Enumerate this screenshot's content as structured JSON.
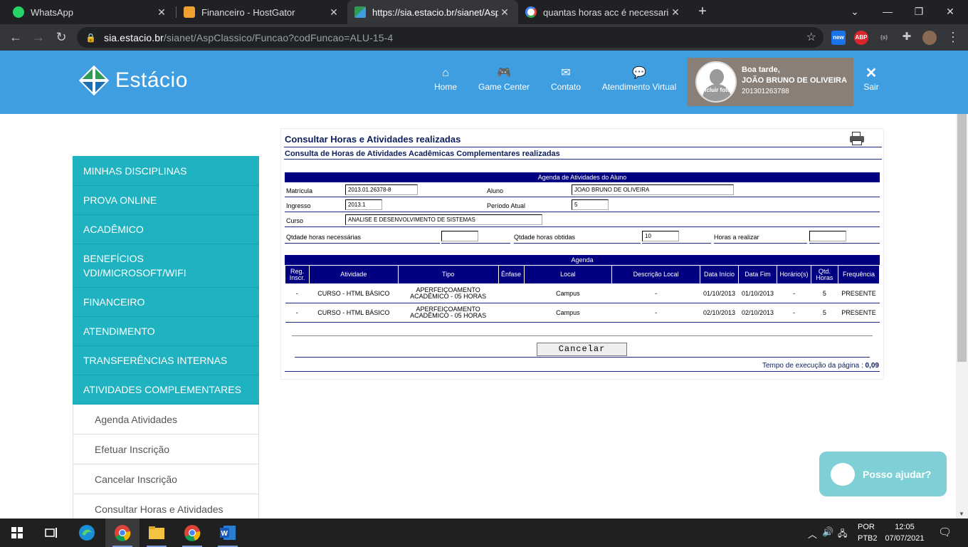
{
  "browser": {
    "tabs": [
      {
        "title": "WhatsApp",
        "icon": "whatsapp-icon",
        "color": "#25d366"
      },
      {
        "title": "Financeiro - HostGator",
        "icon": "hostgator-icon",
        "color": "#f0a030"
      },
      {
        "title": "https://sia.estacio.br/sianet/AspC",
        "icon": "estacio-favicon",
        "color": "#3e9ee0"
      },
      {
        "title": "quantas horas acc é necessario p",
        "icon": "google-icon",
        "color": "#ffffff"
      }
    ],
    "url_host": "sia.estacio.br",
    "url_path": "/sianet/AspClassico/Funcao?codFuncao=ALU-15-4",
    "ext_new": "new",
    "ext_abp": "ABP",
    "ext_s": "(s)"
  },
  "header": {
    "logo_text": "Estácio",
    "nav": [
      {
        "label": "Home",
        "icon": "home-icon",
        "glyph": "⌂"
      },
      {
        "label": "Game Center",
        "icon": "gamepad-icon",
        "glyph": "🎮"
      },
      {
        "label": "Contato",
        "icon": "envelope-icon",
        "glyph": "✉"
      },
      {
        "label": "Atendimento Virtual",
        "icon": "chat-icon",
        "glyph": "💬"
      }
    ],
    "avatar_label": "Incluir foto",
    "greeting": "Boa tarde,",
    "user_name": "JOÃO BRUNO DE OLIVEIRA",
    "user_id": "201301263788",
    "logout": "Sair"
  },
  "sidebar": {
    "items": [
      {
        "label": "MINHAS DISCIPLINAS"
      },
      {
        "label": "PROVA ONLINE"
      },
      {
        "label": "ACADÊMICO"
      },
      {
        "label": "BENEFÍCIOS VDI/MICROSOFT/WIFI"
      },
      {
        "label": "FINANCEIRO"
      },
      {
        "label": "ATENDIMENTO"
      },
      {
        "label": "TRANSFERÊNCIAS INTERNAS"
      },
      {
        "label": "ATIVIDADES COMPLEMENTARES"
      }
    ],
    "subitems": [
      {
        "label": "Agenda Atividades"
      },
      {
        "label": "Efetuar Inscrição"
      },
      {
        "label": "Cancelar Inscrição"
      },
      {
        "label": "Consultar Horas e Atividades"
      }
    ]
  },
  "main": {
    "title": "Consultar Horas e Atividades realizadas",
    "subtitle": "Consulta de Horas de Atividades Acadêmicas Complementares realizadas",
    "agenda_bar": "Agenda de Atividades do Aluno",
    "fields": {
      "matricula_label": "Matrícula",
      "matricula": "2013.01.26378-8",
      "aluno_label": "Aluno",
      "aluno": "JOAO BRUNO DE OLIVEIRA",
      "ingresso_label": "Ingresso",
      "ingresso": "2013.1",
      "periodo_label": "Período Atual",
      "periodo": "5",
      "curso_label": "Curso",
      "curso": "ANALISE E DESENVOLVIMENTO DE SISTEMAS",
      "necessarias_label": "Qtdade horas necessárias",
      "necessarias": "",
      "obtidas_label": "Qtdade horas obtidas",
      "obtidas": "10",
      "realizar_label": "Horas a realizar",
      "realizar": ""
    },
    "table_bar": "Agenda",
    "columns": [
      "Reg. Inscr.",
      "Atividade",
      "Tipo",
      "Ênfase",
      "Local",
      "Descrição Local",
      "Data Início",
      "Data Fim",
      "Horário(s)",
      "Qtd. Horas",
      "Frequência"
    ],
    "rows": [
      [
        "-",
        "CURSO - HTML BÁSICO",
        "APERFEIÇOAMENTO ACADÊMICO - 05 HORAS",
        "",
        "Campus",
        "-",
        "01/10/2013",
        "01/10/2013",
        "-",
        "5",
        "PRESENTE"
      ],
      [
        "-",
        "CURSO - HTML BÁSICO",
        "APERFEIÇOAMENTO ACADÊMICO - 05 HORAS",
        "",
        "Campus",
        "-",
        "02/10/2013",
        "02/10/2013",
        "-",
        "5",
        "PRESENTE"
      ]
    ],
    "cancel_label": "Cancelar",
    "exec_label": "Tempo de execução da página :",
    "exec_value": "0,09"
  },
  "chat": {
    "label": "Posso ajudar?"
  },
  "taskbar": {
    "lang": "POR",
    "layout": "PTB2",
    "time": "12:05",
    "date": "07/07/2021"
  }
}
